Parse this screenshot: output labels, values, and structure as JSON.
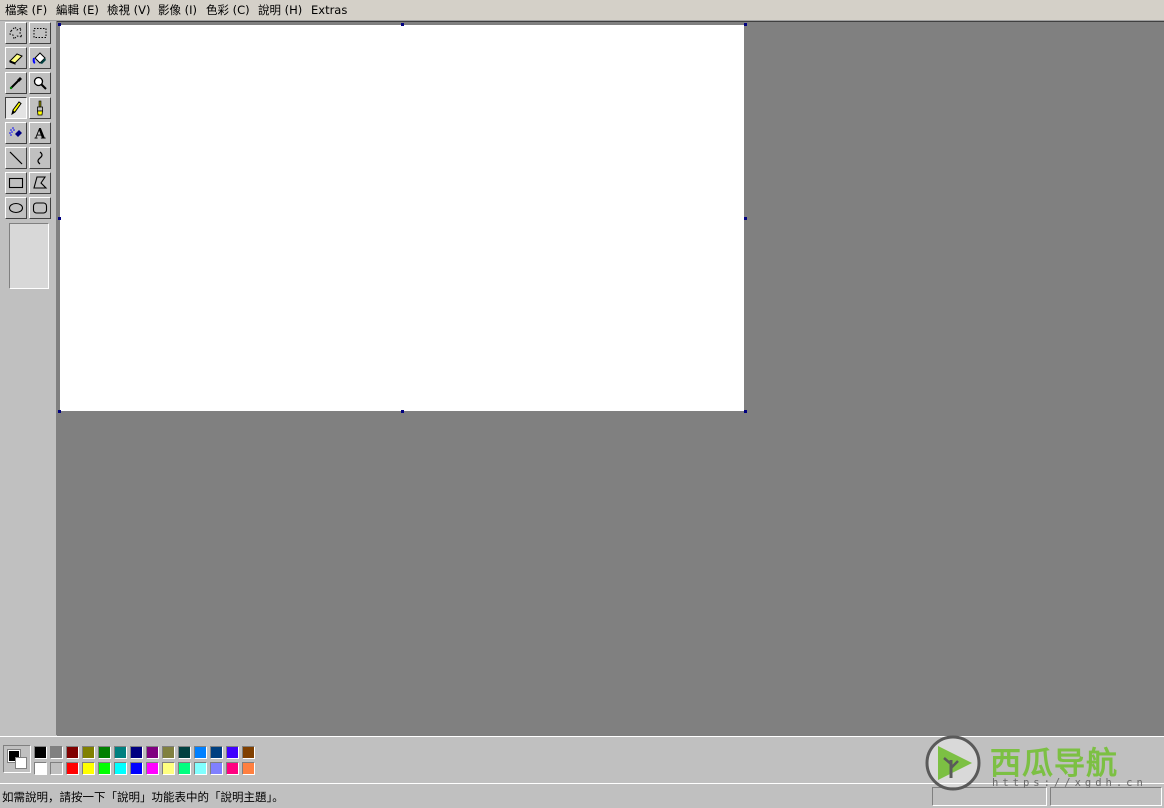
{
  "menu": [
    {
      "id": "file",
      "label": "檔案 (F)"
    },
    {
      "id": "edit",
      "label": "編輯 (E)"
    },
    {
      "id": "view",
      "label": "檢視 (V)"
    },
    {
      "id": "image",
      "label": "影像 (I)"
    },
    {
      "id": "colors",
      "label": "色彩 (C)"
    },
    {
      "id": "help",
      "label": "說明 (H)"
    },
    {
      "id": "extras",
      "label": "Extras"
    }
  ],
  "tools": [
    {
      "id": "free-select",
      "icon": "free-form-select-icon"
    },
    {
      "id": "rect-select",
      "icon": "rect-select-icon"
    },
    {
      "id": "eraser",
      "icon": "eraser-icon"
    },
    {
      "id": "fill",
      "icon": "fill-bucket-icon"
    },
    {
      "id": "pick-color",
      "icon": "color-picker-icon"
    },
    {
      "id": "magnifier",
      "icon": "magnifier-icon"
    },
    {
      "id": "pencil",
      "icon": "pencil-icon",
      "active": true
    },
    {
      "id": "brush",
      "icon": "brush-icon"
    },
    {
      "id": "airbrush",
      "icon": "airbrush-icon"
    },
    {
      "id": "text",
      "icon": "text-icon",
      "glyph": "A"
    },
    {
      "id": "line",
      "icon": "line-icon"
    },
    {
      "id": "curve",
      "icon": "curve-icon"
    },
    {
      "id": "rectangle",
      "icon": "rectangle-icon"
    },
    {
      "id": "polygon",
      "icon": "polygon-icon"
    },
    {
      "id": "ellipse",
      "icon": "ellipse-icon"
    },
    {
      "id": "rounded-rectangle",
      "icon": "rounded-rect-icon"
    }
  ],
  "current_colors": {
    "foreground": "#000000",
    "background": "#ffffff"
  },
  "palette_top": [
    "#000000",
    "#808080",
    "#800000",
    "#808000",
    "#008000",
    "#008080",
    "#000080",
    "#800080",
    "#808040",
    "#004040",
    "#0080ff",
    "#004080",
    "#4000ff",
    "#804000"
  ],
  "palette_bottom": [
    "#ffffff",
    "#c0c0c0",
    "#ff0000",
    "#ffff00",
    "#00ff00",
    "#00ffff",
    "#0000ff",
    "#ff00ff",
    "#ffff80",
    "#00ff80",
    "#80ffff",
    "#8080ff",
    "#ff0080",
    "#ff8040"
  ],
  "status": {
    "text": "如需說明，請按一下「說明」功能表中的「說明主題」。"
  },
  "watermark": {
    "name": "西瓜导航",
    "url": "https://xgdh.cn",
    "accent": "#7cc043"
  },
  "colors": {
    "workspace": "#808080",
    "chrome": "#c0c0c0",
    "canvas": "#ffffff",
    "selection_handle": "#000080"
  }
}
